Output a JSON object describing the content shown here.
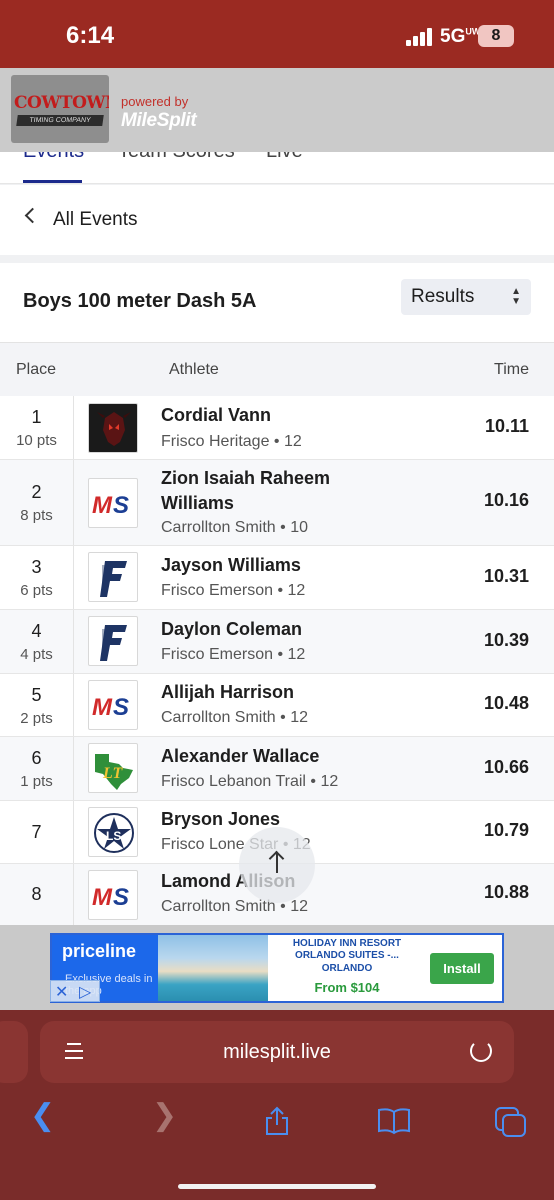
{
  "status_bar": {
    "time": "6:14",
    "network": "5G",
    "network_sub": "UW",
    "battery": "8"
  },
  "header": {
    "logo_top": "COWTOWN",
    "logo_bottom": "TIMING COMPANY",
    "powered_by": "powered by",
    "brand": "MileSplit"
  },
  "tabs": [
    {
      "label": "Events",
      "active": true
    },
    {
      "label": "Team Scores",
      "active": false
    },
    {
      "label": "Live",
      "active": false
    }
  ],
  "nav": {
    "back_label": "All Events"
  },
  "event": {
    "title": "Boys 100 meter Dash 5A",
    "view_select": "Results"
  },
  "table": {
    "headers": {
      "place": "Place",
      "athlete": "Athlete",
      "time": "Time"
    },
    "rows": [
      {
        "place": "1",
        "pts": "10 pts",
        "name": "Cordial Vann",
        "school": "Frisco Heritage • 12",
        "time": "10.11",
        "logo": "heritage-logo"
      },
      {
        "place": "2",
        "pts": "8 pts",
        "name": "Zion Isaiah Raheem Williams",
        "school": "Carrollton Smith • 10",
        "time": "10.16",
        "logo": "ms-logo"
      },
      {
        "place": "3",
        "pts": "6 pts",
        "name": "Jayson Williams",
        "school": "Frisco Emerson • 12",
        "time": "10.31",
        "logo": "emerson-logo"
      },
      {
        "place": "4",
        "pts": "4 pts",
        "name": "Daylon Coleman",
        "school": "Frisco Emerson • 12",
        "time": "10.39",
        "logo": "emerson-logo"
      },
      {
        "place": "5",
        "pts": "2 pts",
        "name": "Allijah Harrison",
        "school": "Carrollton Smith • 12",
        "time": "10.48",
        "logo": "ms-logo"
      },
      {
        "place": "6",
        "pts": "1 pts",
        "name": "Alexander Wallace",
        "school": "Frisco Lebanon Trail • 12",
        "time": "10.66",
        "logo": "lebanon-trail-logo"
      },
      {
        "place": "7",
        "pts": "",
        "name": "Bryson Jones",
        "school": "Frisco Lone Star • 12",
        "time": "10.79",
        "logo": "lone-star-logo"
      },
      {
        "place": "8",
        "pts": "",
        "name": "Lamond Allison",
        "school": "Carrollton Smith • 12",
        "time": "10.88",
        "logo": "ms-logo"
      }
    ]
  },
  "ad": {
    "brand": "priceline",
    "sub": "Exclusive deals in the app",
    "hotel": "HOLIDAY INN RESORT ORLANDO SUITES -...",
    "city": "ORLANDO",
    "price": "From $104",
    "cta": "Install"
  },
  "browser": {
    "url": "milesplit.live"
  },
  "colors": {
    "status_bar": "#9b2a22",
    "browser_bar": "#7a2c2a",
    "accent": "#1c2a8c",
    "safari_blue": "#4a8ef0",
    "ms_red": "#d12a2a",
    "ms_blue": "#1c3f94"
  }
}
